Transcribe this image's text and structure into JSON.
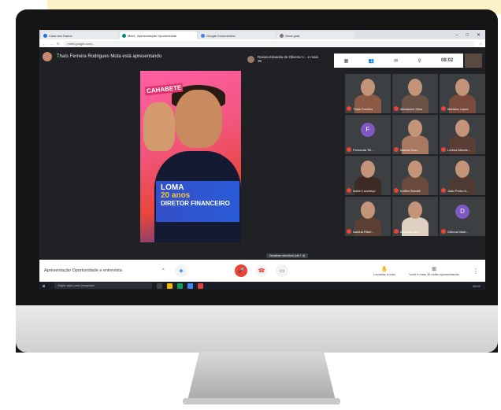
{
  "browser": {
    "tabs": [
      {
        "label": "Casa dos Dados"
      },
      {
        "label": "Meet - Apresentação Oportunidade"
      },
      {
        "label": "Google Documentos"
      },
      {
        "label": "Nova guia"
      }
    ],
    "url": "meet.google.com/...",
    "clock": "08:02"
  },
  "meet": {
    "presenter_text": "Thaís Ferreira Rodrigues Mota está apresentando",
    "viewer_text": "Raissa Eduarda de Oliveira V... e mais 35",
    "tooltip": "Desativar microfone (ctrl + d)",
    "meeting_title": "Apresentação Oportunidade e entrevista",
    "raise_hand": "Levantar a mão",
    "you_present": "Você e mais 35 estão apresentando"
  },
  "slide": {
    "tag": "CAHABETE",
    "name": "LOMA",
    "years": "20 anos",
    "role": "DIRETOR FINANCEIRO"
  },
  "participants": [
    {
      "name": "Thais Ferreira",
      "type": "video",
      "color": "#8a5a44"
    },
    {
      "name": "Alexandre Silva",
      "type": "video",
      "color": "#6b5247"
    },
    {
      "name": "Mariana Lopes",
      "type": "video",
      "color": "#7a4a3a"
    },
    {
      "name": "Fernanda Tel...",
      "type": "initial",
      "initial": "F",
      "color": "#7e57c2"
    },
    {
      "name": "Marina Guu...",
      "type": "video",
      "color": "#a87860"
    },
    {
      "name": "Lorena Mende...",
      "type": "video",
      "color": "#5a3e36"
    },
    {
      "name": "Isabel Lourenço",
      "type": "video",
      "color": "#3e2a24"
    },
    {
      "name": "Kaillen Bonatti",
      "type": "video",
      "color": "#6a4a3c"
    },
    {
      "name": "João Pedro A...",
      "type": "video",
      "color": "#4d3a32"
    },
    {
      "name": "Isabela Ribei...",
      "type": "video",
      "color": "#5c4034"
    },
    {
      "name": "Amanda Lim...",
      "type": "video",
      "color": "#e0d0c4"
    },
    {
      "name": "Débora Marti...",
      "type": "initial",
      "initial": "D",
      "color": "#7e57c2"
    }
  ],
  "taskbar": {
    "search_placeholder": "Digite aqui para pesquisar",
    "tray_time": "08:02"
  }
}
